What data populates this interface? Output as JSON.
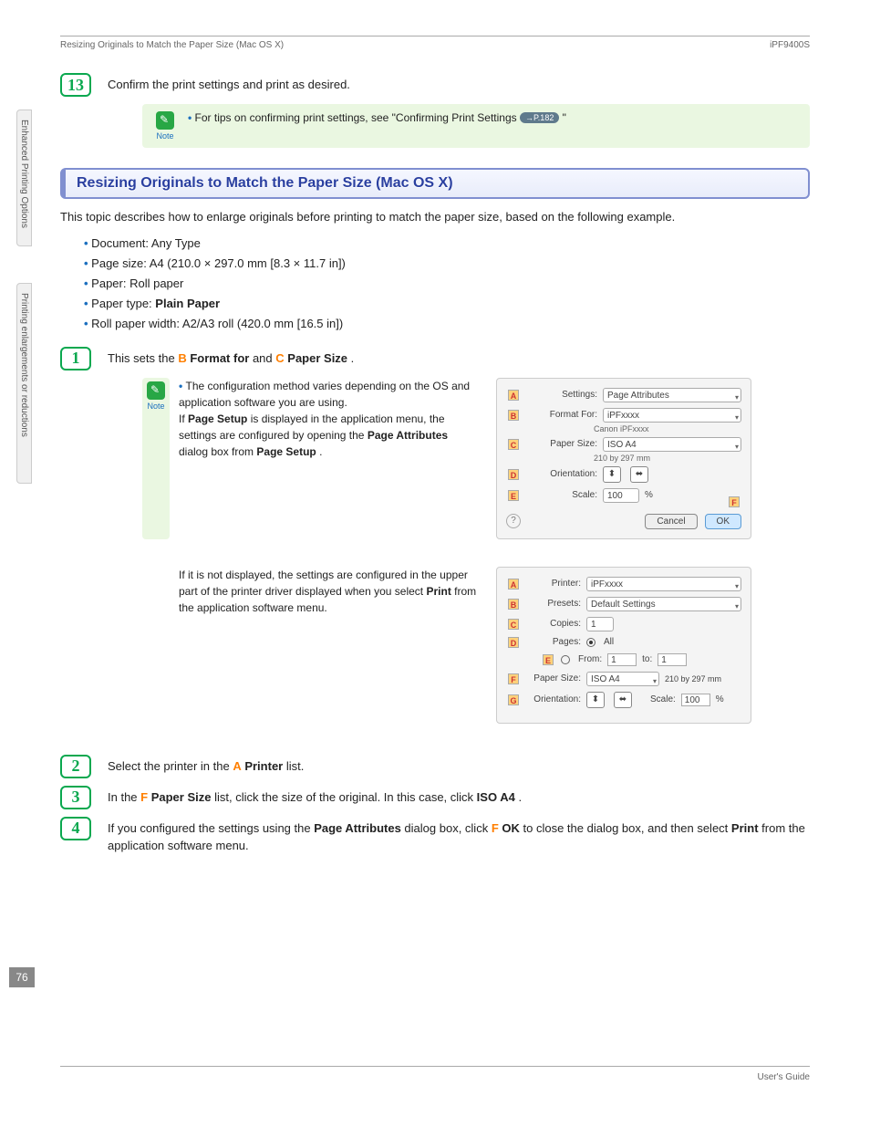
{
  "header": {
    "left": "Resizing Originals to Match the Paper Size (Mac OS X)",
    "right": "iPF9400S"
  },
  "footer": {
    "right": "User's Guide"
  },
  "page_number": "76",
  "sidebar": {
    "tab1": "Enhanced Printing Options",
    "tab2": "Printing enlargements or reductions"
  },
  "step13": {
    "num": "13",
    "text": "Confirm the print settings and print as desired.",
    "note_label": "Note",
    "note_prefix": "For tips on confirming print settings, see \"Confirming Print Settings ",
    "note_xref": "→P.182",
    "note_suffix": " \""
  },
  "section": {
    "title": "Resizing Originals to Match the Paper Size (Mac OS X)"
  },
  "intro": "This topic describes how to enlarge originals before printing to match the paper size, based on the following example.",
  "specs": {
    "l1": "Document: Any Type",
    "l2": "Page size: A4 (210.0 × 297.0 mm [8.3 × 11.7 in])",
    "l3": "Paper: Roll paper",
    "l4_a": "Paper type: ",
    "l4_b": "Plain Paper",
    "l5": "Roll paper width: A2/A3 roll (420.0 mm [16.5 in])"
  },
  "step1": {
    "num": "1",
    "pre": "This sets the ",
    "B": "B",
    "mid1": "Format for",
    "and": " and ",
    "C": "C",
    "mid2": "Paper Size",
    "end": ".",
    "note_label": "Note",
    "note1a": "The configuration method varies depending on the OS and application software you are using.",
    "note1b_a": "If ",
    "note1b_b": "Page Setup",
    "note1b_c": " is displayed in the application menu, the settings are configured by opening the ",
    "note1b_d": "Page Attributes",
    "note1b_e": " dialog box from ",
    "note1b_f": "Page Setup",
    "note1b_g": ".",
    "note2_a": "If it is not displayed, the settings are configured in the upper part of the printer driver displayed when you select ",
    "note2_b": "Print",
    "note2_c": " from the application software menu."
  },
  "dialog1": {
    "A": "A",
    "settings_l": "Settings:",
    "settings_v": "Page Attributes",
    "B": "B",
    "format_l": "Format For:",
    "format_v": "iPFxxxx",
    "format_sub": "Canon iPFxxxx",
    "C": "C",
    "paper_l": "Paper Size:",
    "paper_v": "ISO A4",
    "paper_sub": "210 by 297 mm",
    "D": "D",
    "orient_l": "Orientation:",
    "E": "E",
    "scale_l": "Scale:",
    "scale_v": "100",
    "pct": "%",
    "F": "F",
    "cancel": "Cancel",
    "ok": "OK",
    "help": "?"
  },
  "dialog2": {
    "A": "A",
    "printer_l": "Printer:",
    "printer_v": "iPFxxxx",
    "B": "B",
    "presets_l": "Presets:",
    "presets_v": "Default Settings",
    "C": "C",
    "copies_l": "Copies:",
    "copies_v": "1",
    "D": "D",
    "pages_l": "Pages:",
    "all": "All",
    "E": "E",
    "from_l": "From:",
    "from_v": "1",
    "to_l": "to:",
    "to_v": "1",
    "F": "F",
    "paper_l": "Paper Size:",
    "paper_v": "ISO A4",
    "paper_dim": "210 by 297 mm",
    "G": "G",
    "orient_l": "Orientation:",
    "scale_l": "Scale:",
    "scale_v": "100",
    "pct": "%"
  },
  "step2": {
    "num": "2",
    "a": "Select the printer in the ",
    "A": "A",
    "b": "Printer",
    "c": " list."
  },
  "step3": {
    "num": "3",
    "a": "In the ",
    "F": "F",
    "b": "Paper Size",
    "c": " list, click the size of the original. In this case, click ",
    "d": "ISO A4",
    "e": "."
  },
  "step4": {
    "num": "4",
    "a": "If you configured the settings using the ",
    "b": "Page Attributes",
    "c": " dialog box, click ",
    "F": "F",
    "d": "OK",
    "e": " to close the dialog box, and then select ",
    "f": "Print",
    "g": " from the application software menu."
  }
}
